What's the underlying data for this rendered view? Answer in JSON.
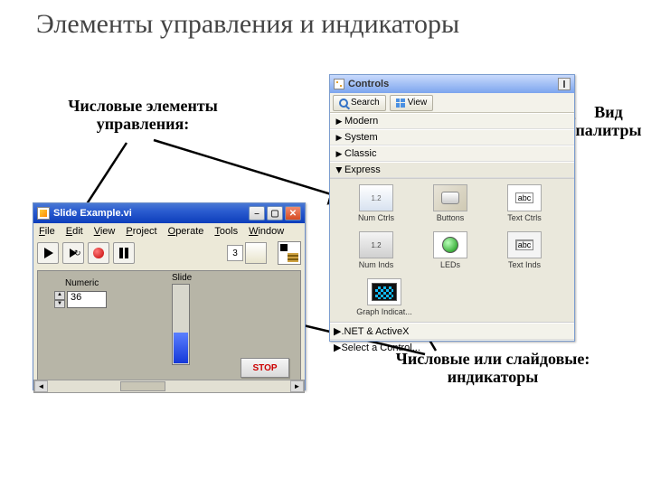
{
  "slide": {
    "title": "Элементы управления и  индикаторы"
  },
  "annotations": {
    "numeric_controls": "Числовые элементы\nуправления:",
    "palette_view": "Вид\nпалитры",
    "numeric_slide_indicators": "Числовые или слайдовые:\nиндикаторы"
  },
  "vi_window": {
    "title": "Slide Example.vi",
    "menu": {
      "file": "File",
      "edit": "Edit",
      "view": "View",
      "project": "Project",
      "operate": "Operate",
      "tools": "Tools",
      "window": "Window"
    },
    "toolbar": {
      "font_size": "3"
    },
    "panel": {
      "numeric_label": "Numeric",
      "numeric_value": "36",
      "slide_label": "Slide",
      "stop_label": "STOP"
    }
  },
  "controls_palette": {
    "title": "Controls",
    "toolbar": {
      "search": "Search",
      "view": "View"
    },
    "categories": {
      "modern": "Modern",
      "system": "System",
      "classic": "Classic",
      "express": "Express"
    },
    "express": {
      "items": {
        "num_ctrls": "Num Ctrls",
        "buttons": "Buttons",
        "text_ctrls": "Text Ctrls",
        "num_inds": "Num Inds",
        "leds": "LEDs",
        "text_inds": "Text Inds",
        "graph_ind": "Graph Indicat..."
      }
    },
    "footer": {
      "dotnet": ".NET & ActiveX",
      "select": "Select a Control..."
    }
  }
}
